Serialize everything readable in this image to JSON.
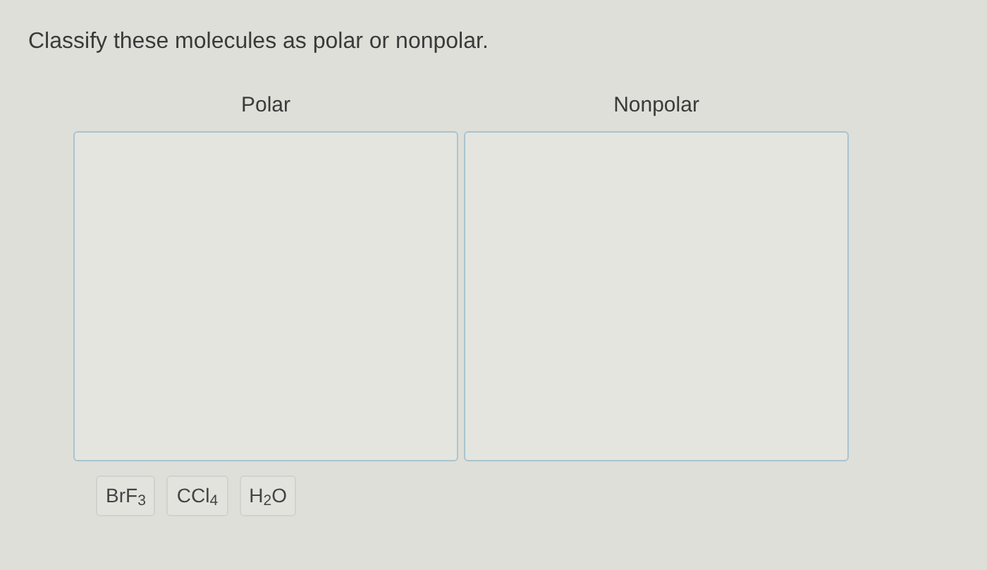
{
  "prompt": "Classify these molecules as polar or nonpolar.",
  "bins": [
    {
      "label": "Polar"
    },
    {
      "label": "Nonpolar"
    }
  ],
  "items": [
    "BrF$_{3}$",
    "CCl$_{4}$",
    "H$_{2}$O"
  ]
}
